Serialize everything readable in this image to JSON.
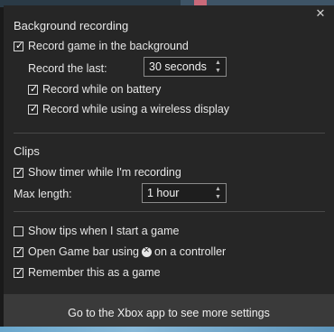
{
  "close_glyph": "✕",
  "background_recording": {
    "title": "Background recording",
    "record_in_background": {
      "label": "Record game in the background",
      "checked": true
    },
    "record_last": {
      "label": "Record the last:",
      "value": "30 seconds"
    },
    "record_on_battery": {
      "label": "Record while on battery",
      "checked": true
    },
    "record_wireless": {
      "label": "Record while using a wireless display",
      "checked": true
    }
  },
  "clips": {
    "title": "Clips",
    "show_timer": {
      "label": "Show timer while I'm recording",
      "checked": true
    },
    "max_length": {
      "label": "Max length:",
      "value": "1 hour"
    }
  },
  "general": {
    "show_tips": {
      "label": "Show tips when I start a game",
      "checked": false
    },
    "open_game_bar": {
      "label_before": "Open Game bar using",
      "label_after": "on a controller",
      "icon": "xbox-icon",
      "checked": true
    },
    "remember_game": {
      "label": "Remember this as a game",
      "checked": true
    }
  },
  "footer": {
    "label": "Go to the Xbox app to see more settings"
  }
}
